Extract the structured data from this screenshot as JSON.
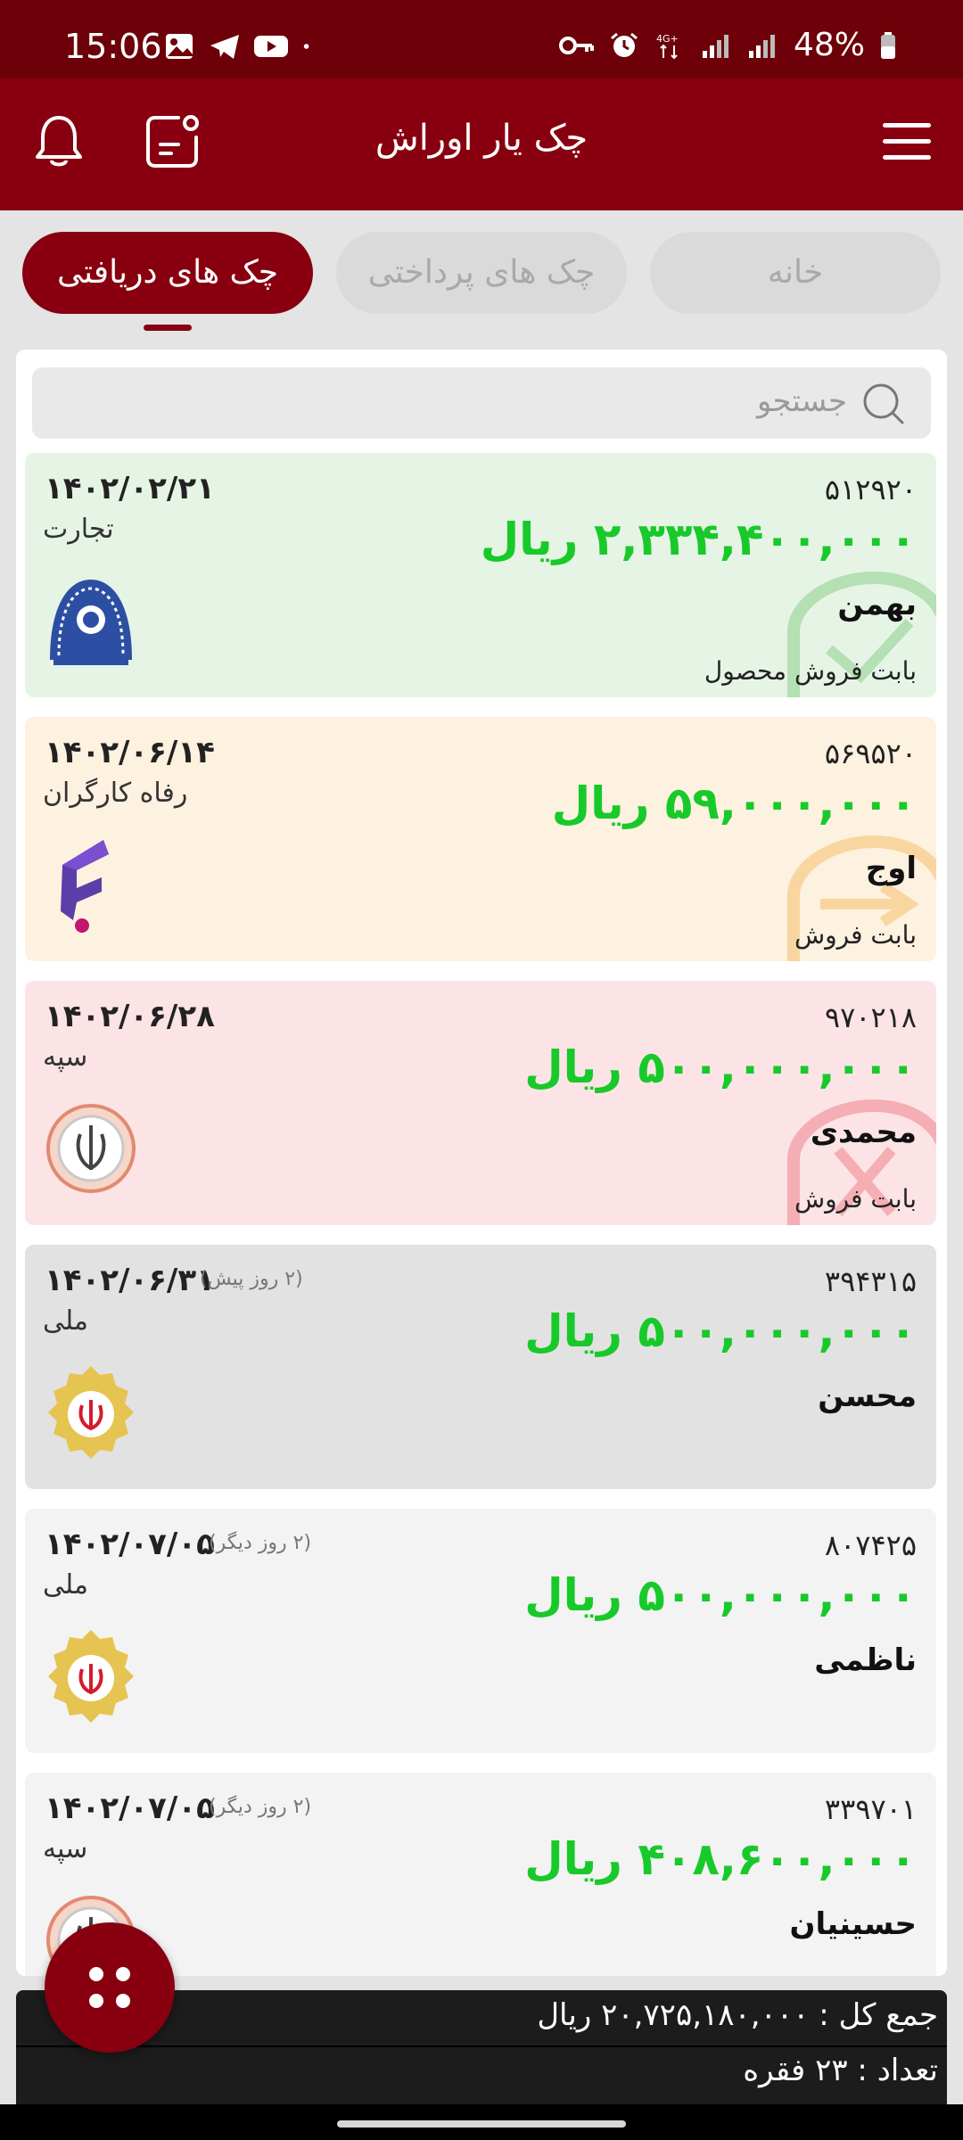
{
  "status": {
    "time": "15:06",
    "battery": "48%",
    "network": "4G+"
  },
  "app": {
    "title": "چک یار اوراش"
  },
  "tabs": [
    {
      "label": "خانه",
      "active": false
    },
    {
      "label": "چک های پرداختی",
      "active": false
    },
    {
      "label": "چک های دریافتی",
      "active": true
    }
  ],
  "search": {
    "placeholder": "جستجو"
  },
  "cheques": [
    {
      "number": "۵۱۲۹۲۰",
      "amount": "۲,۳۳۴,۴۰۰,۰۰۰ ریال",
      "name": "بهمن",
      "description": "بابت فروش محصول",
      "date": "۱۴۰۲/۰۲/۲۱",
      "relative": "",
      "bank": "تجارت",
      "logo": "tejarat-bank-logo",
      "status_icon": "passed-check-icon",
      "background": "#e6f4e6"
    },
    {
      "number": "۵۶۹۵۲۰",
      "amount": "۵۹,۰۰۰,۰۰۰ ریال",
      "name": "اوج",
      "description": "بابت فروش",
      "date": "۱۴۰۲/۰۶/۱۴",
      "relative": "",
      "bank": "رفاه کارگران",
      "logo": "refah-bank-logo",
      "status_icon": "pending-transfer-icon",
      "background": "#fdf1e0"
    },
    {
      "number": "۹۷۰۲۱۸",
      "amount": "۵۰۰,۰۰۰,۰۰۰ ریال",
      "name": "محمدی",
      "description": "بابت فروش",
      "date": "۱۴۰۲/۰۶/۲۸",
      "relative": "",
      "bank": "سپه",
      "logo": "sepah-bank-logo",
      "status_icon": "bounced-check-icon",
      "background": "#fce4e6"
    },
    {
      "number": "۳۹۴۳۱۵",
      "amount": "۵۰۰,۰۰۰,۰۰۰ ریال",
      "name": "محسن",
      "description": "",
      "date": "۱۴۰۲/۰۶/۳۱",
      "relative": "(۲ روز پیش)",
      "bank": "ملی",
      "logo": "melli-bank-logo",
      "status_icon": "",
      "background": "#e2e2e2"
    },
    {
      "number": "۸۰۷۴۲۵",
      "amount": "۵۰۰,۰۰۰,۰۰۰ ریال",
      "name": "ناظمی",
      "description": "",
      "date": "۱۴۰۲/۰۷/۰۵",
      "relative": "(۲ روز دیگر)",
      "bank": "ملی",
      "logo": "melli-bank-logo",
      "status_icon": "",
      "background": "#f3f3f3"
    },
    {
      "number": "۳۳۹۷۰۱",
      "amount": "۴۰۸,۶۰۰,۰۰۰ ریال",
      "name": "حسینیان",
      "description": "",
      "date": "۱۴۰۲/۰۷/۰۵",
      "relative": "(۲ روز دیگر)",
      "bank": "سپه",
      "logo": "sepah-bank-logo",
      "status_icon": "",
      "background": "#f3f3f3"
    }
  ],
  "summary": {
    "total": "جمع کل : ۲۰,۷۲۵,۱۸۰,۰۰۰ ریال",
    "count": "تعداد : ۲۳ فقره"
  },
  "colors": {
    "primary": "#880010",
    "status_bar": "#6d0008",
    "amount_green": "#18c92a"
  }
}
